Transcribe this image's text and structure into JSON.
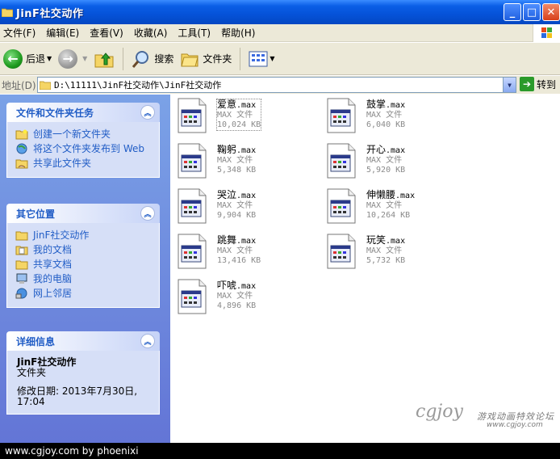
{
  "window": {
    "title": "JinF社交动作"
  },
  "menu": [
    "文件(F)",
    "编辑(E)",
    "查看(V)",
    "收藏(A)",
    "工具(T)",
    "帮助(H)"
  ],
  "toolbar": {
    "back": "后退",
    "search": "搜索",
    "folders": "文件夹"
  },
  "address": {
    "label": "地址(D)",
    "path": "D:\\11111\\JinF社交动作\\JinF社交动作",
    "go": "转到"
  },
  "tasks": {
    "title": "文件和文件夹任务",
    "items": [
      "创建一个新文件夹",
      "将这个文件夹发布到 Web",
      "共享此文件夹"
    ]
  },
  "places": {
    "title": "其它位置",
    "items": [
      "JinF社交动作",
      "我的文档",
      "共享文档",
      "我的电脑",
      "网上邻居"
    ]
  },
  "details": {
    "title": "详细信息",
    "name": "JinF社交动作",
    "type": "文件夹",
    "modified": "修改日期: 2013年7月30日, 17:04"
  },
  "files": [
    {
      "name": "爱意",
      "ext": ".max",
      "type": "MAX 文件",
      "size": "10,024 KB"
    },
    {
      "name": "鼓掌",
      "ext": ".max",
      "type": "MAX 文件",
      "size": "6,040 KB"
    },
    {
      "name": "鞠躬",
      "ext": ".max",
      "type": "MAX 文件",
      "size": "5,348 KB"
    },
    {
      "name": "开心",
      "ext": ".max",
      "type": "MAX 文件",
      "size": "5,920 KB"
    },
    {
      "name": "哭泣",
      "ext": ".max",
      "type": "MAX 文件",
      "size": "9,904 KB"
    },
    {
      "name": "伸懒腰",
      "ext": ".max",
      "type": "MAX 文件",
      "size": "10,264 KB"
    },
    {
      "name": "跳舞",
      "ext": ".max",
      "type": "MAX 文件",
      "size": "13,416 KB"
    },
    {
      "name": "玩笑",
      "ext": ".max",
      "type": "MAX 文件",
      "size": "5,732 KB"
    },
    {
      "name": "吓唬",
      "ext": ".max",
      "type": "MAX 文件",
      "size": "4,896 KB"
    }
  ],
  "watermark": {
    "logo": "cgjoy",
    "cn": "游戏动画特效论坛",
    "url": "www.cgjoy.com"
  },
  "credit": "www.cgjoy.com by phoenixi"
}
